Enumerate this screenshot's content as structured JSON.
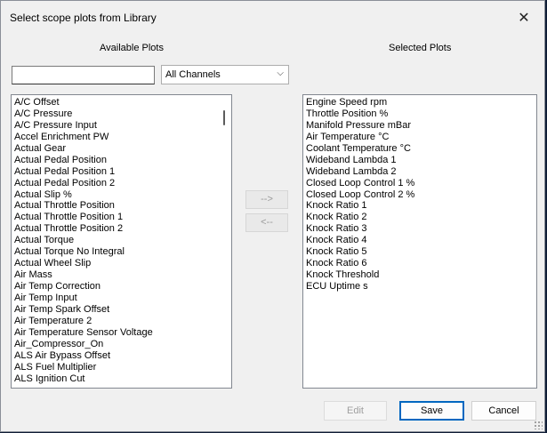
{
  "window": {
    "title": "Select scope plots from Library"
  },
  "available": {
    "heading": "Available Plots",
    "search_value": "",
    "filter_selected": "All Channels",
    "items": [
      "A/C Offset",
      "A/C Pressure",
      "A/C Pressure Input",
      "Accel Enrichment PW",
      "Actual Gear",
      "Actual Pedal Position",
      "Actual Pedal Position 1",
      "Actual Pedal Position 2",
      "Actual Slip %",
      "Actual Throttle Position",
      "Actual Throttle Position 1",
      "Actual Throttle Position 2",
      "Actual Torque",
      "Actual Torque No Integral",
      "Actual Wheel Slip",
      "Air Mass",
      "Air Temp Correction",
      "Air Temp Input",
      "Air Temp Spark Offset",
      "Air Temperature 2",
      "Air Temperature Sensor Voltage",
      "Air_Compressor_On",
      "ALS Air Bypass Offset",
      "ALS Fuel Multiplier",
      "ALS Ignition Cut"
    ]
  },
  "selected": {
    "heading": "Selected Plots",
    "items": [
      "Engine Speed rpm",
      "Throttle Position %",
      "Manifold Pressure mBar",
      "Air Temperature °C",
      "Coolant Temperature °C",
      "Wideband Lambda 1",
      "Wideband Lambda 2",
      "Closed Loop Control 1 %",
      "Closed Loop Control 2 %",
      "Knock Ratio 1",
      "Knock Ratio 2",
      "Knock Ratio 3",
      "Knock Ratio 4",
      "Knock Ratio 5",
      "Knock Ratio 6",
      "Knock Threshold",
      "ECU Uptime s"
    ]
  },
  "transfer": {
    "add_label": "-->",
    "remove_label": "<--"
  },
  "buttons": {
    "edit": "Edit",
    "save": "Save",
    "cancel": "Cancel"
  },
  "icons": {
    "close": "close-icon",
    "dropdown": "chevron-down-icon"
  },
  "colors": {
    "accent": "#0067c0",
    "dialog_bg": "#f0f0f0"
  }
}
